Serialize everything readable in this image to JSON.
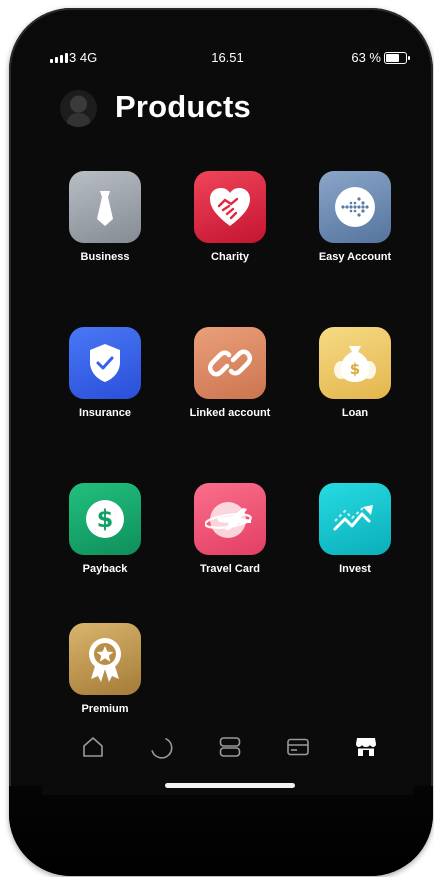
{
  "status_bar": {
    "carrier": "3 4G",
    "time": "16.51",
    "battery_percent": "63 %",
    "battery_level": 0.63
  },
  "header": {
    "title": "Products"
  },
  "products": [
    {
      "label": "Business",
      "icon": "tie-icon",
      "color": "#9aa0a8"
    },
    {
      "label": "Charity",
      "icon": "heart-handshake-icon",
      "color": "#e0283f"
    },
    {
      "label": "Easy Account",
      "icon": "dotted-arrow-icon",
      "color": "#6e8db5"
    },
    {
      "label": "Insurance",
      "icon": "shield-check-icon",
      "color": "#3760e8"
    },
    {
      "label": "Linked account",
      "icon": "link-icon",
      "color": "#df8a63"
    },
    {
      "label": "Loan",
      "icon": "money-bag-icon",
      "color": "#f1cb66"
    },
    {
      "label": "Payback",
      "icon": "dollar-coin-icon",
      "color": "#18a86e"
    },
    {
      "label": "Travel Card",
      "icon": "plane-globe-icon",
      "color": "#f0587a"
    },
    {
      "label": "Invest",
      "icon": "trend-up-icon",
      "color": "#19c9d2"
    },
    {
      "label": "Premium",
      "icon": "award-medal-icon",
      "color": "#c29a52"
    }
  ],
  "tab_bar": {
    "tabs": [
      {
        "name": "home",
        "icon": "home-icon",
        "active": false
      },
      {
        "name": "activity",
        "icon": "loading-arc-icon",
        "active": false
      },
      {
        "name": "accounts",
        "icon": "stacked-cards-icon",
        "active": false
      },
      {
        "name": "card",
        "icon": "credit-card-icon",
        "active": false
      },
      {
        "name": "products",
        "icon": "store-icon",
        "active": true
      }
    ]
  }
}
